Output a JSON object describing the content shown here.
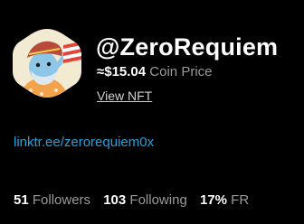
{
  "profile": {
    "username": "@ZeroRequiem",
    "avatar_icon": "nft-character-avatar-icon"
  },
  "coin": {
    "price": "≈$15.04",
    "label": "Coin Price"
  },
  "links": {
    "view_nft": "View NFT",
    "bio_url": "linktr.ee/zerorequiem0x"
  },
  "stats": {
    "followers_count": "51",
    "followers_label": "Followers",
    "following_count": "103",
    "following_label": "Following",
    "fr_value": "17%",
    "fr_label": "FR"
  },
  "colors": {
    "background": "#000000",
    "link_blue": "#1fa2e0",
    "muted_gray": "#9a9a9a"
  }
}
